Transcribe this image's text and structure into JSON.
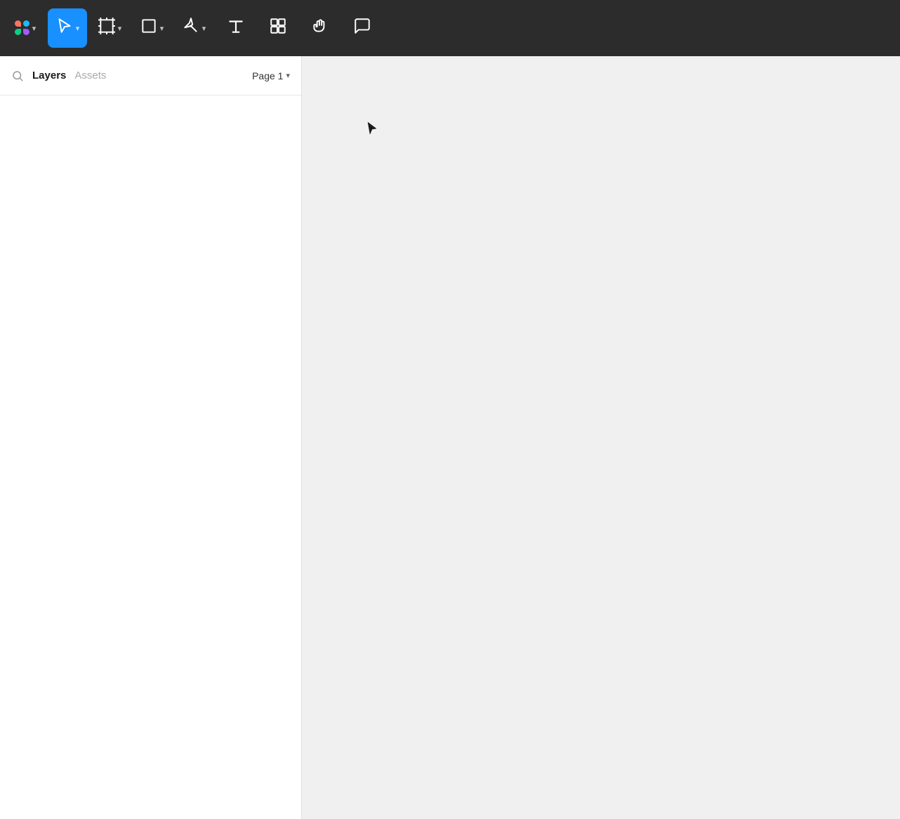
{
  "toolbar": {
    "logo_label": "Figma",
    "tools": [
      {
        "name": "logo",
        "label": "Figma Logo",
        "active": false,
        "has_chevron": true
      },
      {
        "name": "select",
        "label": "Select Tool",
        "active": true,
        "has_chevron": true
      },
      {
        "name": "frame",
        "label": "Frame Tool",
        "active": false,
        "has_chevron": true
      },
      {
        "name": "shape",
        "label": "Shape Tool",
        "active": false,
        "has_chevron": true
      },
      {
        "name": "pen",
        "label": "Pen Tool",
        "active": false,
        "has_chevron": true
      },
      {
        "name": "text",
        "label": "Text Tool",
        "active": false,
        "has_chevron": false
      },
      {
        "name": "components",
        "label": "Components Tool",
        "active": false,
        "has_chevron": false
      },
      {
        "name": "hand",
        "label": "Hand Tool",
        "active": false,
        "has_chevron": false
      },
      {
        "name": "comment",
        "label": "Comment Tool",
        "active": false,
        "has_chevron": false
      }
    ]
  },
  "left_panel": {
    "search_placeholder": "Search layers",
    "tabs": [
      {
        "name": "layers",
        "label": "Layers",
        "active": true
      },
      {
        "name": "assets",
        "label": "Assets",
        "active": false
      }
    ],
    "page_selector": {
      "label": "Page 1",
      "chevron": "▾"
    }
  },
  "canvas": {
    "background_color": "#f0f0f0"
  }
}
